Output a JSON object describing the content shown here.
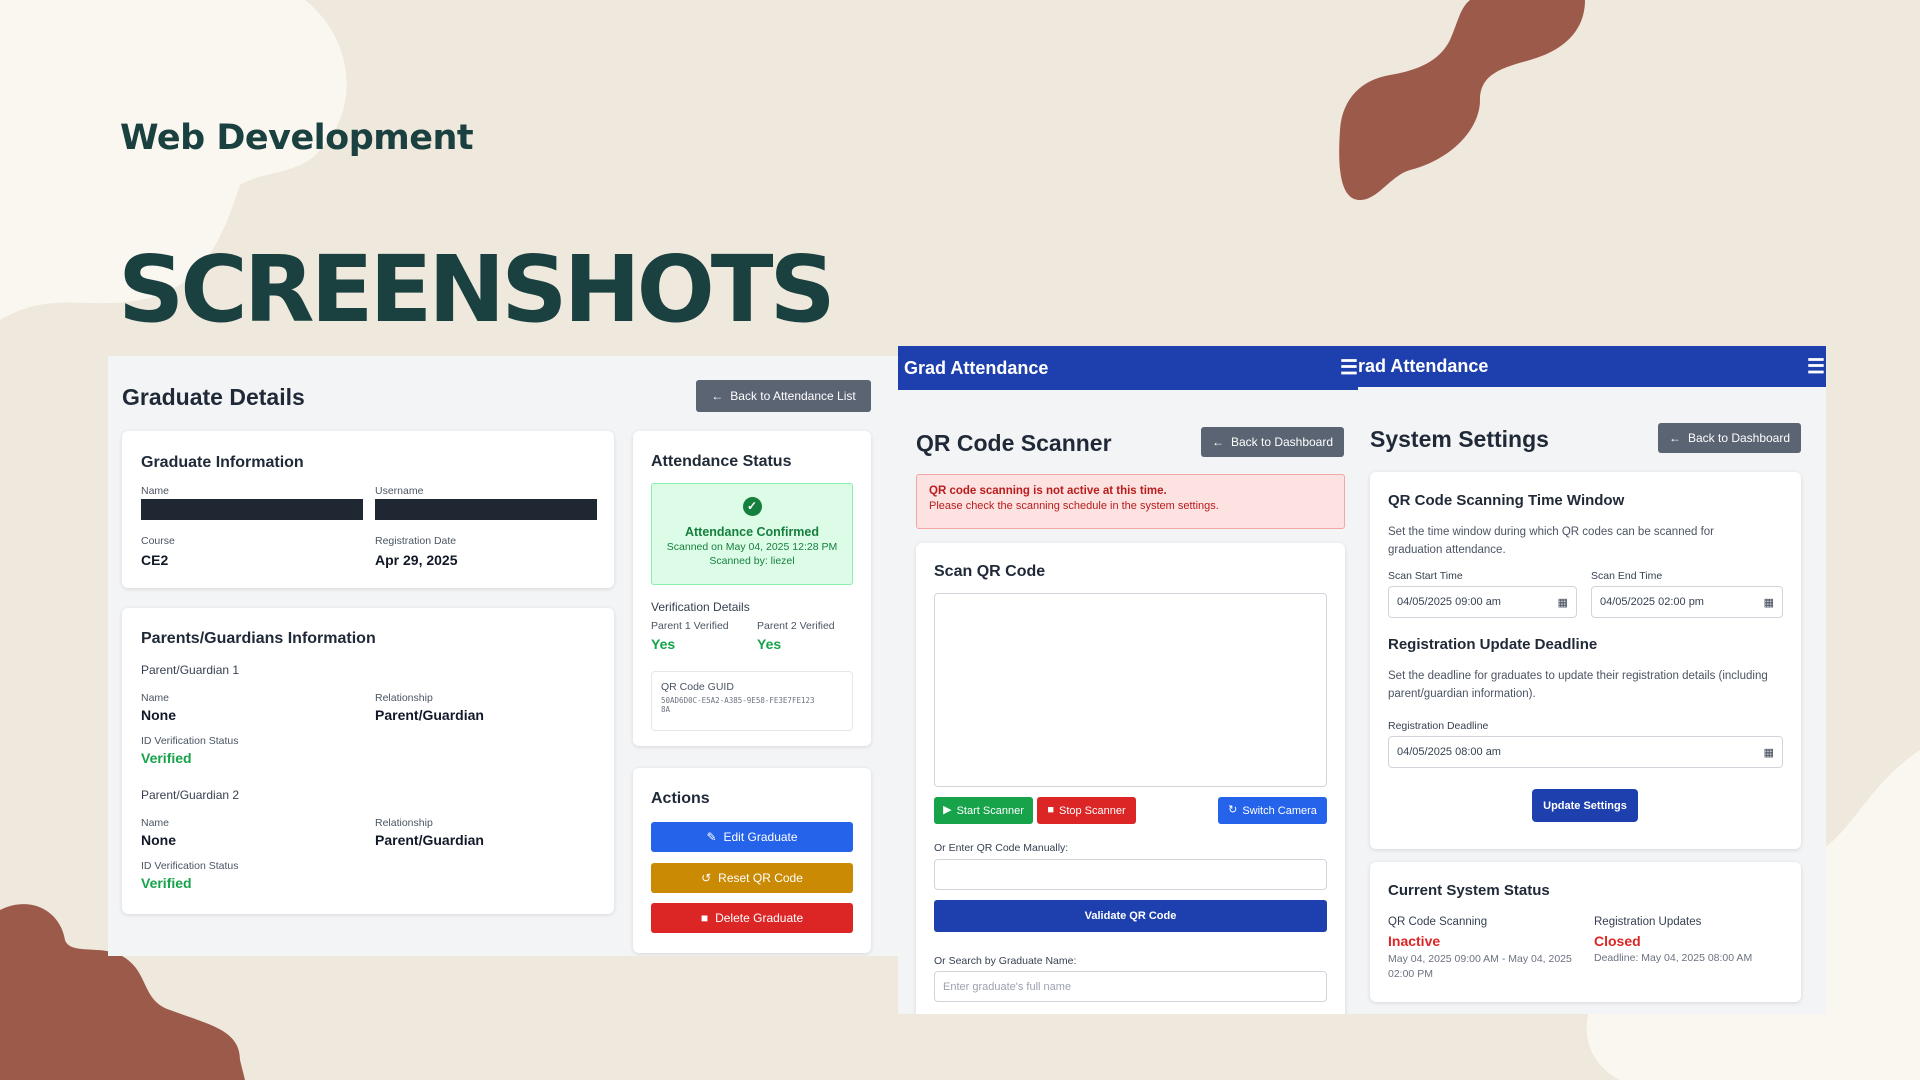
{
  "slide": {
    "kicker": "Web Development",
    "title": "SCREENSHOTS"
  },
  "graduate": {
    "page_title": "Graduate Details",
    "back_label": "Back to Attendance List",
    "info": {
      "title": "Graduate Information",
      "name_label": "Name",
      "username_label": "Username",
      "course_label": "Course",
      "course": "CE2",
      "reg_date_label": "Registration Date",
      "reg_date": "Apr 29, 2025"
    },
    "parents": {
      "title": "Parents/Guardians Information",
      "p1_heading": "Parent/Guardian 1",
      "p1_name_label": "Name",
      "p1_name": "None",
      "p1_rel_label": "Relationship",
      "p1_rel": "Parent/Guardian",
      "p1_id_label": "ID Verification Status",
      "p1_id": "Verified",
      "p2_heading": "Parent/Guardian 2",
      "p2_name_label": "Name",
      "p2_name": "None",
      "p2_rel_label": "Relationship",
      "p2_rel": "Parent/Guardian",
      "p2_id_label": "ID Verification Status",
      "p2_id": "Verified"
    },
    "attendance": {
      "title": "Attendance Status",
      "confirmed": "Attendance Confirmed",
      "scanned_on": "Scanned on May 04, 2025 12:28 PM",
      "scanned_by": "Scanned by: liezel",
      "verification_title": "Verification Details",
      "p1_label": "Parent 1 Verified",
      "p1_value": "Yes",
      "p2_label": "Parent 2 Verified",
      "p2_value": "Yes",
      "guid_label": "QR Code GUID",
      "guid_line1": "50AD6D0C-E5A2-A385-9E58-FE3E7FE123",
      "guid_line2": "8A"
    },
    "actions": {
      "title": "Actions",
      "edit": "Edit Graduate",
      "reset": "Reset QR Code",
      "delete": "Delete Graduate"
    }
  },
  "scanner": {
    "app_name": "Grad Attendance",
    "page_title": "QR Code Scanner",
    "back_label": "Back to Dashboard",
    "alert_title": "QR code scanning is not active at this time.",
    "alert_body": "Please check the scanning schedule in the system settings.",
    "scan_title": "Scan QR Code",
    "start": "Start Scanner",
    "stop": "Stop Scanner",
    "switch": "Switch Camera",
    "manual_label": "Or Enter QR Code Manually:",
    "validate": "Validate QR Code",
    "search_label": "Or Search by Graduate Name:",
    "search_placeholder": "Enter graduate's full name"
  },
  "settings": {
    "app_name_partial": "rad Attendance",
    "page_title": "System Settings",
    "back_label": "Back to Dashboard",
    "window_title": "QR Code Scanning Time Window",
    "window_desc": "Set the time window during which QR codes can be scanned for graduation attendance.",
    "start_label": "Scan Start Time",
    "start_value": "04/05/2025 09:00 am",
    "end_label": "Scan End Time",
    "end_value": "04/05/2025 02:00 pm",
    "deadline_title": "Registration Update Deadline",
    "deadline_desc": "Set the deadline for graduates to update their registration details (including parent/guardian information).",
    "deadline_label": "Registration Deadline",
    "deadline_value": "04/05/2025 08:00 am",
    "update": "Update Settings",
    "status_title": "Current System Status",
    "qr_label": "QR Code Scanning",
    "qr_status": "Inactive",
    "qr_detail": "May 04, 2025 09:00 AM - May 04, 2025 02:00 PM",
    "reg_label": "Registration Updates",
    "reg_status": "Closed",
    "reg_detail": "Deadline: May 04, 2025 08:00 AM"
  },
  "colors": {
    "navy": "#1e3fae",
    "primary_blue": "#2563eb",
    "success": "#16a34a",
    "warning": "#ca8a04",
    "danger": "#dc2626",
    "slide_bg": "#efe8dc",
    "slide_text": "#1b4040",
    "accent_brown": "#9c5a4a"
  }
}
